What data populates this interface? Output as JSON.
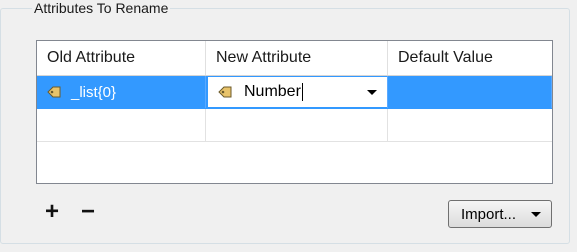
{
  "group": {
    "title": "Attributes To Rename"
  },
  "table": {
    "columns": [
      "Old Attribute",
      "New Attribute",
      "Default Value"
    ],
    "rows": [
      {
        "old": "_list{0}",
        "new": "Number",
        "default": "",
        "selected": true
      },
      {
        "old": "",
        "new": "",
        "default": "",
        "selected": false
      }
    ]
  },
  "toolbar": {
    "add_label": "+",
    "remove_label": "−",
    "import_label": "Import..."
  },
  "icons": {
    "attribute": "attribute-tag-icon",
    "dropdown": "chevron-down-icon"
  },
  "colors": {
    "selection": "#3399ff",
    "background": "#f0f0f0"
  }
}
